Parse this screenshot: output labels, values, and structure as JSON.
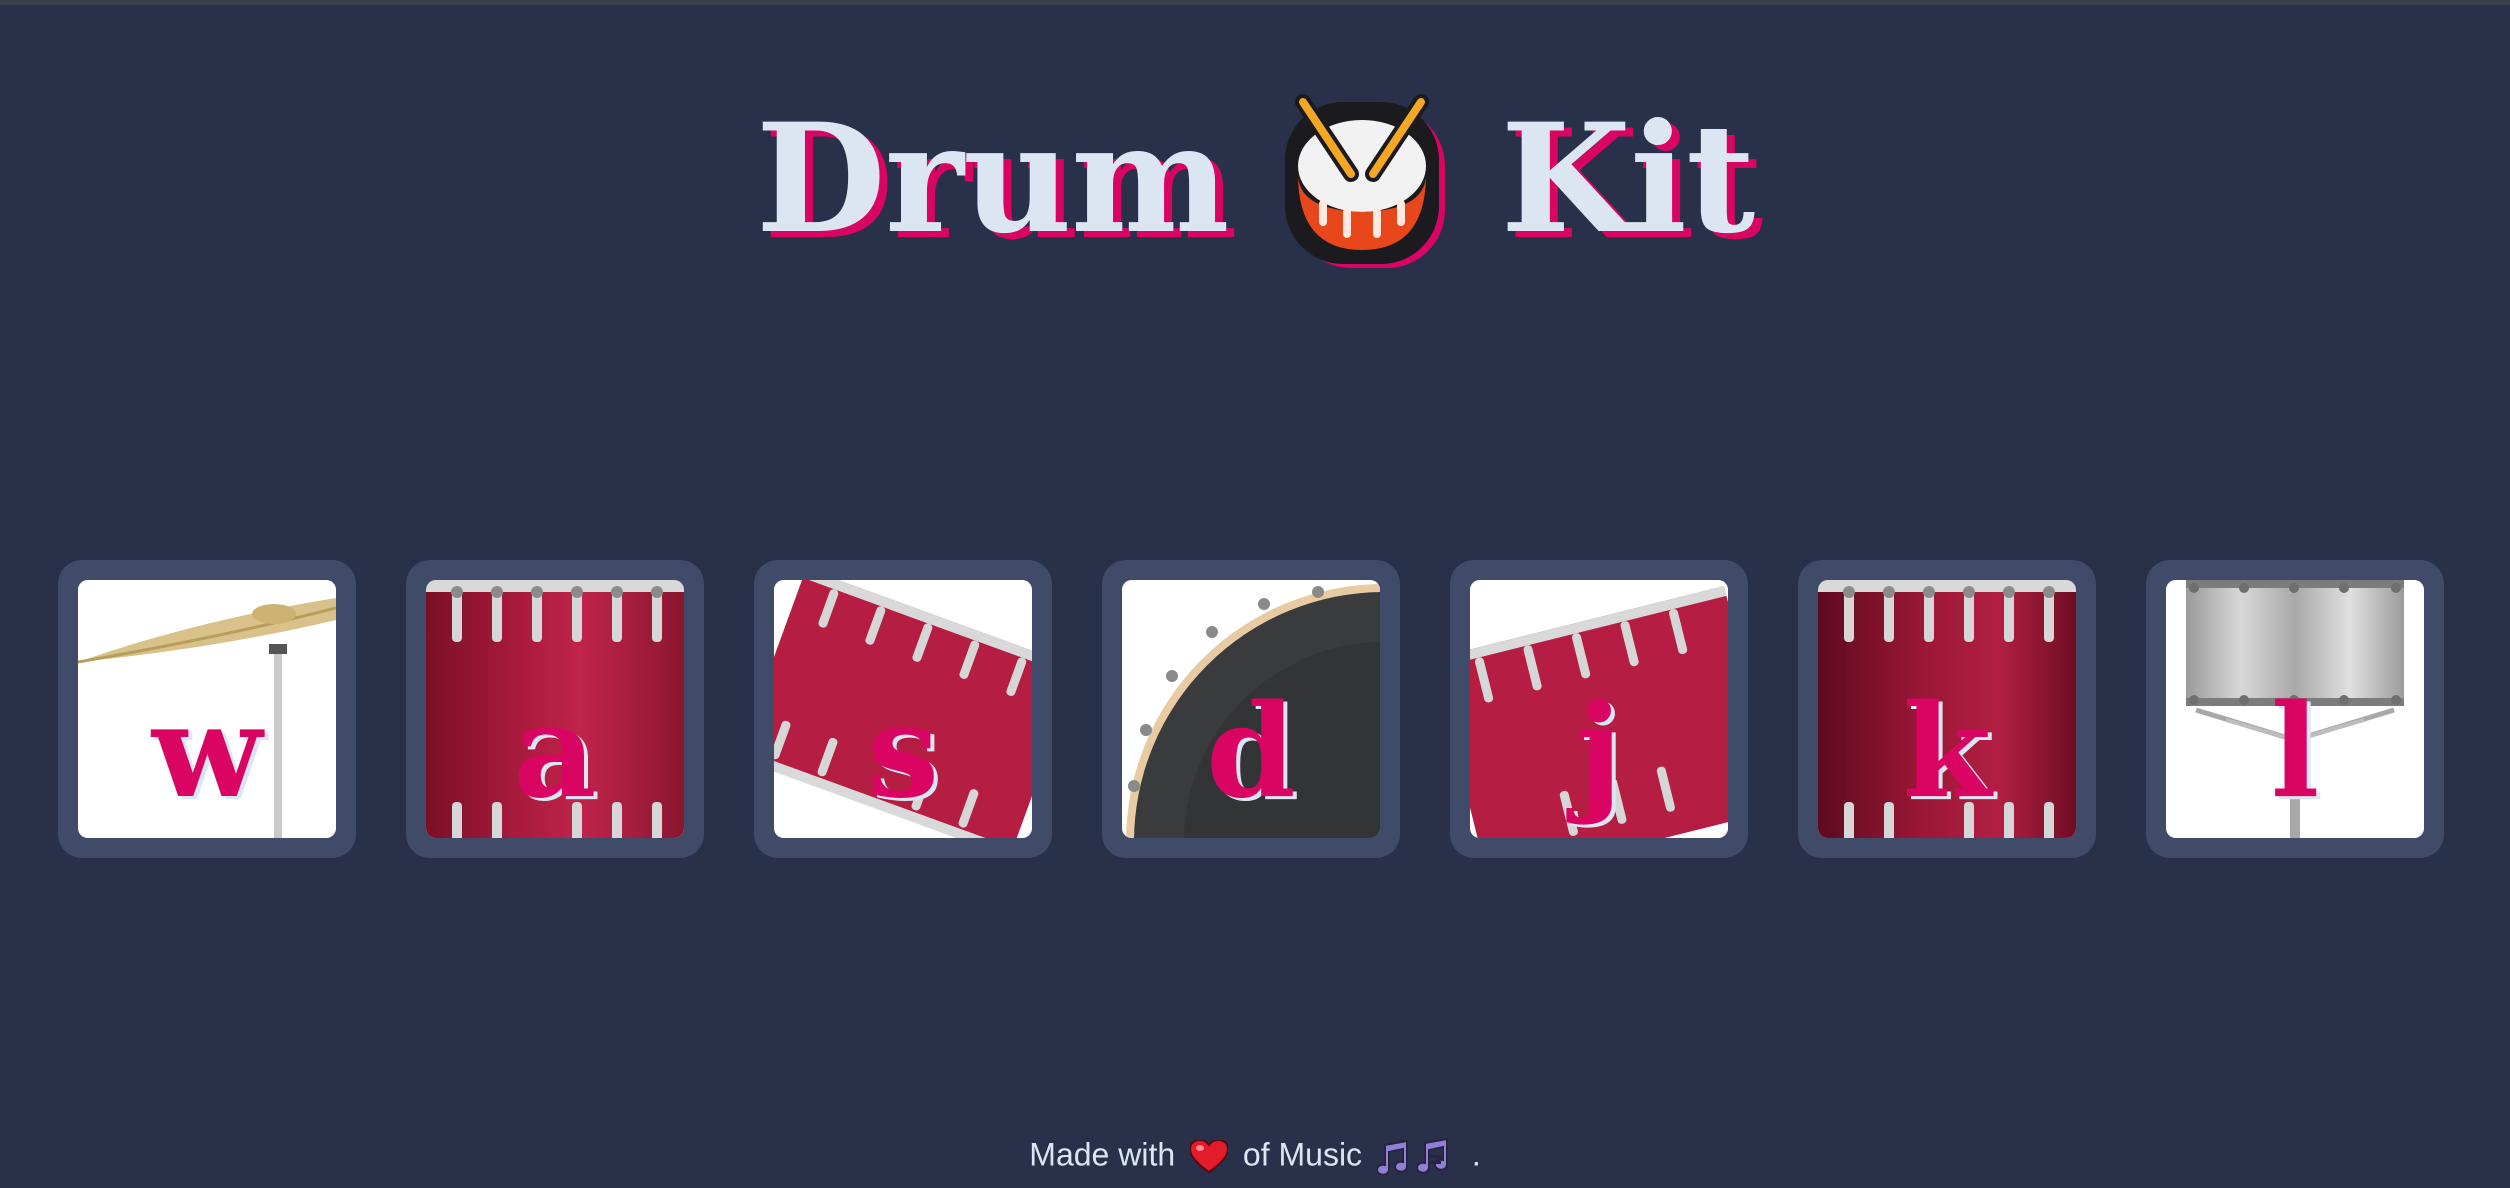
{
  "header": {
    "title_left": "Drum",
    "title_icon": "drum-emoji",
    "title_right": "Kit"
  },
  "keys": [
    {
      "letter": "w",
      "instrument_icon": "cymbal"
    },
    {
      "letter": "a",
      "instrument_icon": "tom-drum"
    },
    {
      "letter": "s",
      "instrument_icon": "tilted-tom-drum"
    },
    {
      "letter": "d",
      "instrument_icon": "bass-drum"
    },
    {
      "letter": "j",
      "instrument_icon": "tilted-tom-drum"
    },
    {
      "letter": "k",
      "instrument_icon": "tom-drum"
    },
    {
      "letter": "l",
      "instrument_icon": "snare-drum"
    }
  ],
  "footer": {
    "prefix": "Made with",
    "heart_icon": "heart-icon",
    "middle": "of Music",
    "music_icon": "music-notes-icon",
    "suffix": "."
  },
  "colors": {
    "background": "#283149",
    "key_frame": "#404b69",
    "accent": "#da0463",
    "light_text": "#dbe6f2"
  }
}
